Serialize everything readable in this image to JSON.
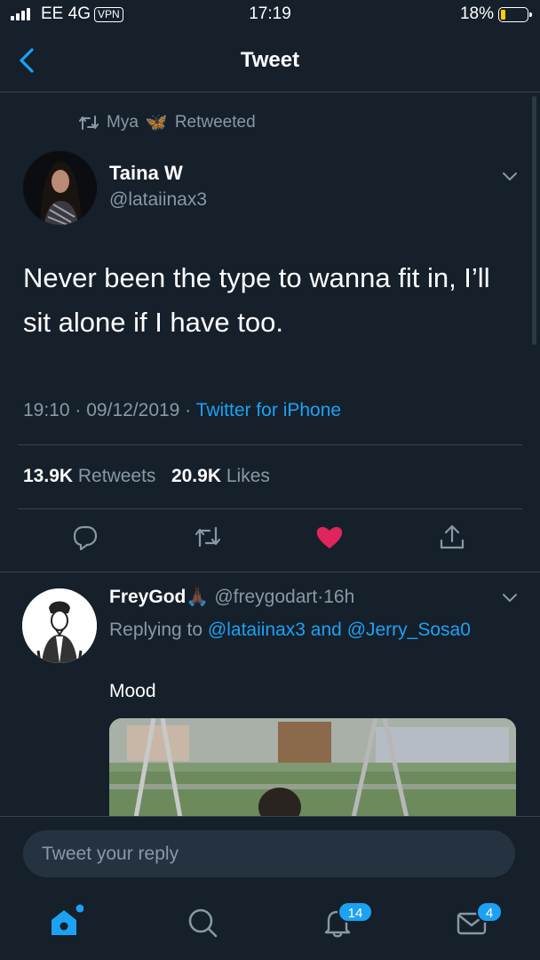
{
  "status_bar": {
    "carrier": "EE 4G",
    "vpn": "VPN",
    "time": "17:19",
    "battery_percent": "18%",
    "battery_level": 0.18
  },
  "nav": {
    "title": "Tweet",
    "back_icon": "chevron-left-icon"
  },
  "retweet_context": {
    "user": "Mya",
    "emoji": "🦋",
    "label": "Retweeted"
  },
  "tweet": {
    "display_name": "Taina W",
    "handle": "@lataiinax3",
    "text": "Never been the type to wanna fit in, I’ll sit alone if I have too.",
    "time": "19:10",
    "date": "09/12/2019",
    "separator": "·",
    "client": "Twitter for iPhone",
    "retweets_count": "13.9K",
    "retweets_label": "Retweets",
    "likes_count": "20.9K",
    "likes_label": "Likes",
    "liked": true
  },
  "reply": {
    "display_name": "FreyGod",
    "emoji": "🙏🏿",
    "handle": "@freygodart",
    "separator": "·",
    "age": "16h",
    "replying_prefix": "Replying to",
    "mention_1": "@lataiinax3",
    "conjunction": "and",
    "mention_2": "@Jerry_Sosa0",
    "text": "Mood"
  },
  "composer": {
    "placeholder": "Tweet your reply"
  },
  "tab_bar": {
    "notifications_badge": "14",
    "messages_badge": "4"
  },
  "colors": {
    "background": "#15202b",
    "accent": "#1da1f2",
    "muted": "#8899a6",
    "divider": "#38444d",
    "like": "#e0245e",
    "battery_low": "#ffcc00"
  }
}
